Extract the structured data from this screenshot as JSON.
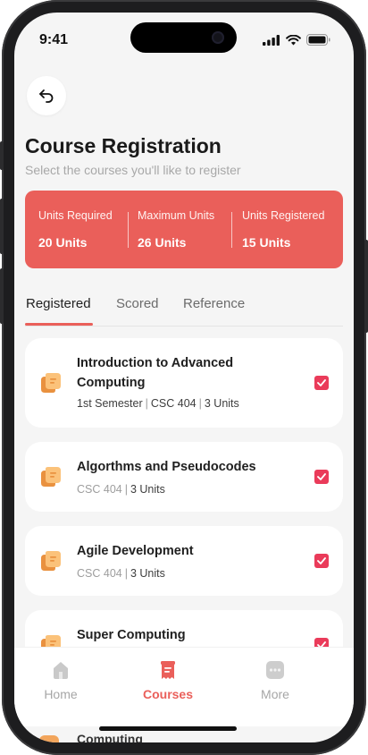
{
  "status_bar": {
    "time": "9:41"
  },
  "header": {
    "title": "Course Registration",
    "subtitle": "Select the courses you'll like to register"
  },
  "stats": [
    {
      "label": "Units Required",
      "value": "20 Units"
    },
    {
      "label": "Maximum Units",
      "value": "26 Units"
    },
    {
      "label": "Units Registered",
      "value": "15 Units"
    }
  ],
  "tabs": [
    {
      "label": "Registered",
      "active": true
    },
    {
      "label": "Scored",
      "active": false
    },
    {
      "label": "Reference",
      "active": false
    }
  ],
  "courses": [
    {
      "name": "Introduction to Advanced Computing",
      "semester": "1st Semester",
      "code": "CSC 404",
      "units": "3 Units",
      "checked": true
    },
    {
      "name": "Algorthms and Pseudocodes",
      "code": "CSC 404",
      "units": "3 Units",
      "checked": true
    },
    {
      "name": "Agile Development",
      "code": "CSC 404",
      "units": "3 Units",
      "checked": true
    },
    {
      "name": "Super Computing",
      "checked": true
    }
  ],
  "peek_text": "Computing",
  "meta_separator": "|",
  "bottom_nav": [
    {
      "label": "Home",
      "icon": "home-icon",
      "active": false
    },
    {
      "label": "Courses",
      "icon": "courses-icon",
      "active": true
    },
    {
      "label": "More",
      "icon": "more-icon",
      "active": false
    }
  ],
  "colors": {
    "accent": "#ea5f5a",
    "checkbox": "#ea3b5a",
    "course_icon": "#f2a55c"
  }
}
